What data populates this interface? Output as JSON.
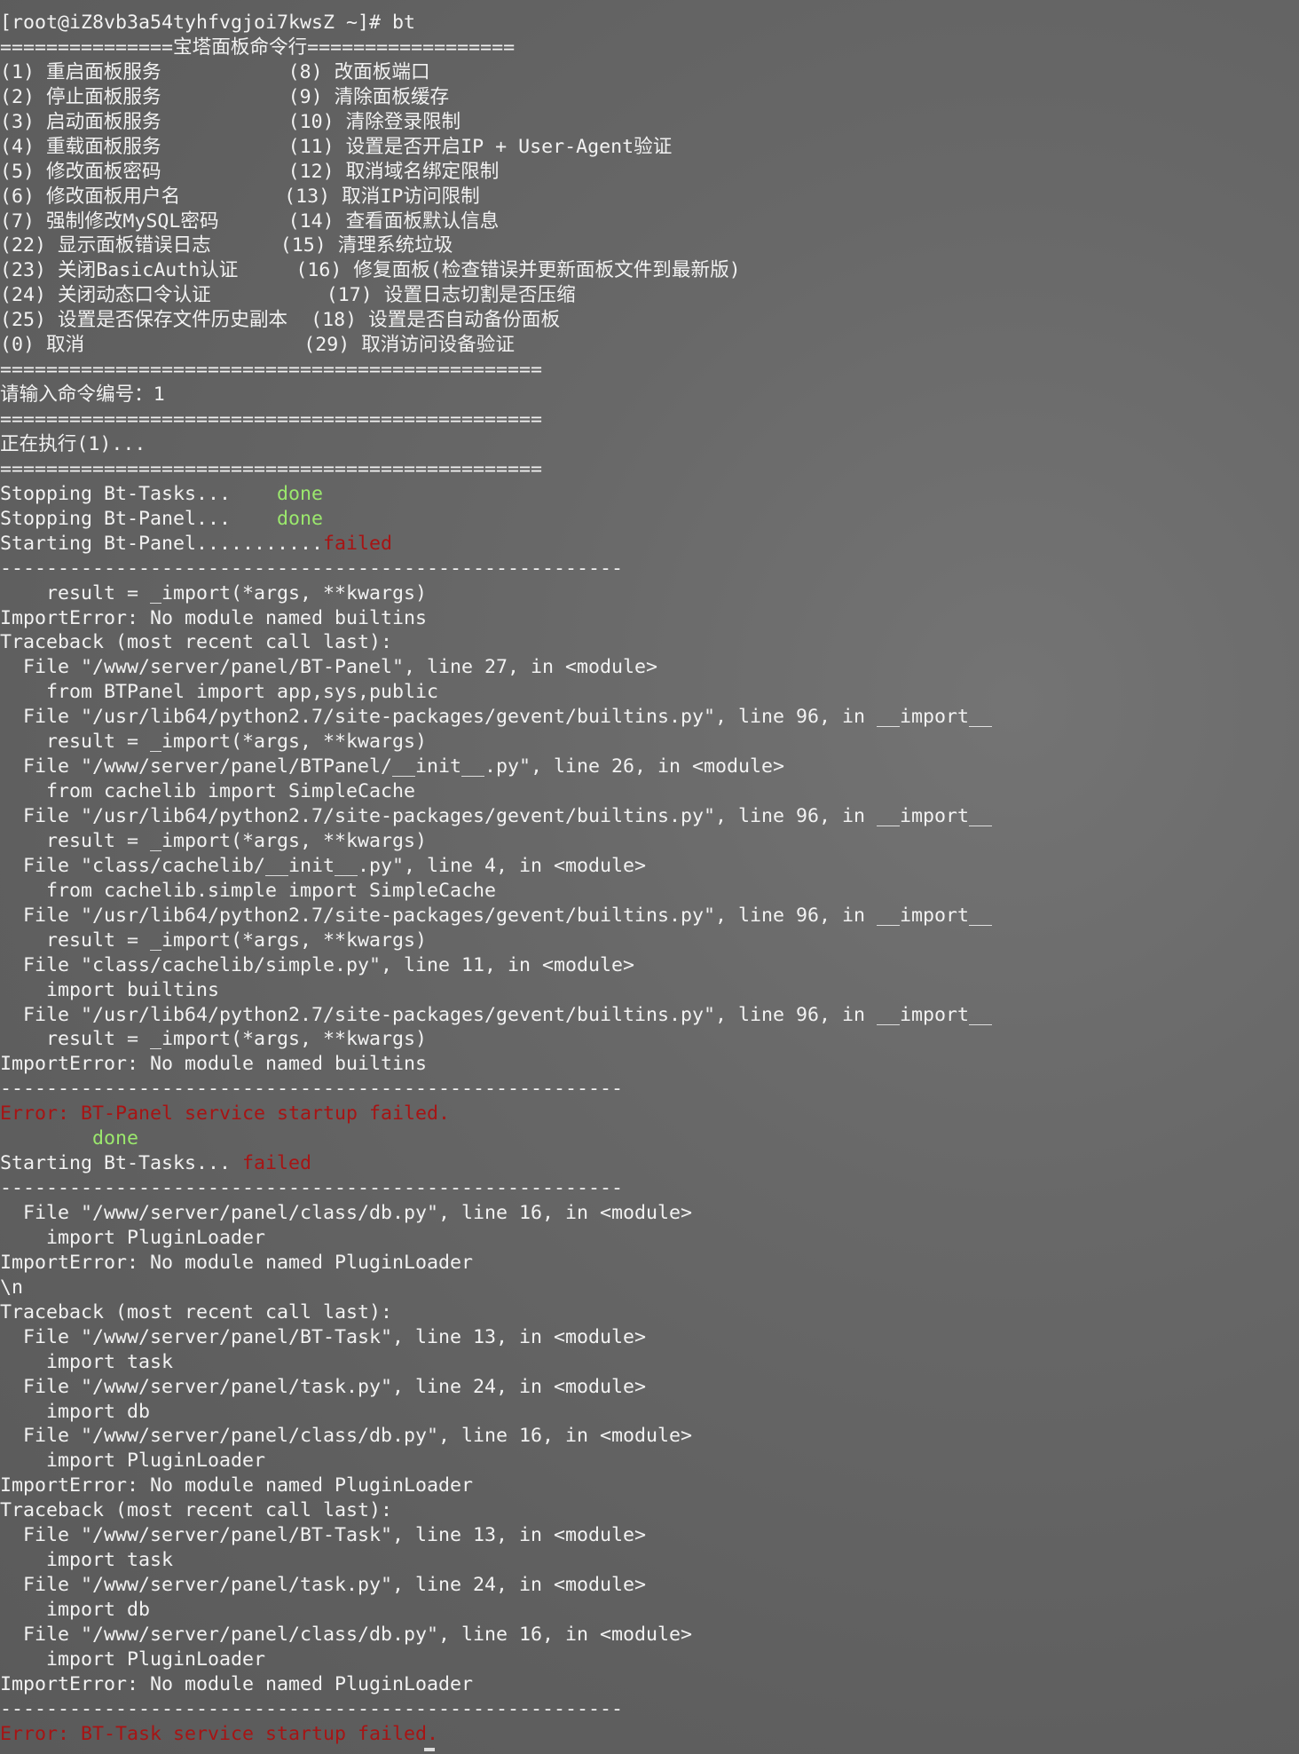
{
  "colors": {
    "background": "#666666",
    "text": "#f2f2f2",
    "success": "#9be86d",
    "failure": "#a71414"
  },
  "lines": [
    {
      "segs": [
        {
          "t": "[root@iZ8vb3a54tyhfvgjoi7kwsZ ~]# bt"
        }
      ]
    },
    {
      "segs": [
        {
          "t": "===============宝塔面板命令行=================="
        }
      ]
    },
    {
      "segs": [
        {
          "t": "(1) 重启面板服务           (8) 改面板端口"
        }
      ]
    },
    {
      "segs": [
        {
          "t": "(2) 停止面板服务           (9) 清除面板缓存"
        }
      ]
    },
    {
      "segs": [
        {
          "t": "(3) 启动面板服务           (10) 清除登录限制"
        }
      ]
    },
    {
      "segs": [
        {
          "t": "(4) 重载面板服务           (11) 设置是否开启IP + User-Agent验证"
        }
      ]
    },
    {
      "segs": [
        {
          "t": "(5) 修改面板密码           (12) 取消域名绑定限制"
        }
      ]
    },
    {
      "segs": [
        {
          "t": "(6) 修改面板用户名         (13) 取消IP访问限制"
        }
      ]
    },
    {
      "segs": [
        {
          "t": "(7) 强制修改MySQL密码      (14) 查看面板默认信息"
        }
      ]
    },
    {
      "segs": [
        {
          "t": "(22) 显示面板错误日志      (15) 清理系统垃圾"
        }
      ]
    },
    {
      "segs": [
        {
          "t": "(23) 关闭BasicAuth认证     (16) 修复面板(检查错误并更新面板文件到最新版)"
        }
      ]
    },
    {
      "segs": [
        {
          "t": "(24) 关闭动态口令认证          (17) 设置日志切割是否压缩"
        }
      ]
    },
    {
      "segs": [
        {
          "t": "(25) 设置是否保存文件历史副本  (18) 设置是否自动备份面板"
        }
      ]
    },
    {
      "segs": [
        {
          "t": "(0) 取消                   (29) 取消访问设备验证"
        }
      ]
    },
    {
      "segs": [
        {
          "t": "==============================================="
        }
      ]
    },
    {
      "segs": [
        {
          "t": "请输入命令编号：1"
        }
      ]
    },
    {
      "segs": [
        {
          "t": "==============================================="
        }
      ]
    },
    {
      "segs": [
        {
          "t": "正在执行(1)..."
        }
      ]
    },
    {
      "segs": [
        {
          "t": "==============================================="
        }
      ]
    },
    {
      "segs": [
        {
          "t": "Stopping Bt-Tasks...    "
        },
        {
          "t": "done",
          "c": "ok"
        }
      ]
    },
    {
      "segs": [
        {
          "t": "Stopping Bt-Panel...    "
        },
        {
          "t": "done",
          "c": "ok"
        }
      ]
    },
    {
      "segs": [
        {
          "t": "Starting Bt-Panel..........."
        },
        {
          "t": "failed",
          "c": "fail"
        }
      ]
    },
    {
      "segs": [
        {
          "t": "------------------------------------------------------"
        }
      ]
    },
    {
      "segs": [
        {
          "t": "    result = _import(*args, **kwargs)"
        }
      ]
    },
    {
      "segs": [
        {
          "t": "ImportError: No module named builtins"
        }
      ]
    },
    {
      "segs": [
        {
          "t": "Traceback (most recent call last):"
        }
      ]
    },
    {
      "segs": [
        {
          "t": "  File \"/www/server/panel/BT-Panel\", line 27, in <module>"
        }
      ]
    },
    {
      "segs": [
        {
          "t": "    from BTPanel import app,sys,public"
        }
      ]
    },
    {
      "segs": [
        {
          "t": "  File \"/usr/lib64/python2.7/site-packages/gevent/builtins.py\", line 96, in __import__"
        }
      ]
    },
    {
      "segs": [
        {
          "t": "    result = _import(*args, **kwargs)"
        }
      ]
    },
    {
      "segs": [
        {
          "t": "  File \"/www/server/panel/BTPanel/__init__.py\", line 26, in <module>"
        }
      ]
    },
    {
      "segs": [
        {
          "t": "    from cachelib import SimpleCache"
        }
      ]
    },
    {
      "segs": [
        {
          "t": "  File \"/usr/lib64/python2.7/site-packages/gevent/builtins.py\", line 96, in __import__"
        }
      ]
    },
    {
      "segs": [
        {
          "t": "    result = _import(*args, **kwargs)"
        }
      ]
    },
    {
      "segs": [
        {
          "t": "  File \"class/cachelib/__init__.py\", line 4, in <module>"
        }
      ]
    },
    {
      "segs": [
        {
          "t": "    from cachelib.simple import SimpleCache"
        }
      ]
    },
    {
      "segs": [
        {
          "t": "  File \"/usr/lib64/python2.7/site-packages/gevent/builtins.py\", line 96, in __import__"
        }
      ]
    },
    {
      "segs": [
        {
          "t": "    result = _import(*args, **kwargs)"
        }
      ]
    },
    {
      "segs": [
        {
          "t": "  File \"class/cachelib/simple.py\", line 11, in <module>"
        }
      ]
    },
    {
      "segs": [
        {
          "t": "    import builtins"
        }
      ]
    },
    {
      "segs": [
        {
          "t": "  File \"/usr/lib64/python2.7/site-packages/gevent/builtins.py\", line 96, in __import__"
        }
      ]
    },
    {
      "segs": [
        {
          "t": "    result = _import(*args, **kwargs)"
        }
      ]
    },
    {
      "segs": [
        {
          "t": "ImportError: No module named builtins"
        }
      ]
    },
    {
      "segs": [
        {
          "t": "------------------------------------------------------"
        }
      ]
    },
    {
      "segs": [
        {
          "t": "Error: BT-Panel service startup failed.",
          "c": "err"
        }
      ]
    },
    {
      "segs": [
        {
          "t": "        "
        },
        {
          "t": "done",
          "c": "ok"
        }
      ]
    },
    {
      "segs": [
        {
          "t": "Starting Bt-Tasks... "
        },
        {
          "t": "failed",
          "c": "fail"
        }
      ]
    },
    {
      "segs": [
        {
          "t": "------------------------------------------------------"
        }
      ]
    },
    {
      "segs": [
        {
          "t": "  File \"/www/server/panel/class/db.py\", line 16, in <module>"
        }
      ]
    },
    {
      "segs": [
        {
          "t": "    import PluginLoader"
        }
      ]
    },
    {
      "segs": [
        {
          "t": "ImportError: No module named PluginLoader"
        }
      ]
    },
    {
      "segs": [
        {
          "t": "\\n"
        }
      ]
    },
    {
      "segs": [
        {
          "t": "Traceback (most recent call last):"
        }
      ]
    },
    {
      "segs": [
        {
          "t": "  File \"/www/server/panel/BT-Task\", line 13, in <module>"
        }
      ]
    },
    {
      "segs": [
        {
          "t": "    import task"
        }
      ]
    },
    {
      "segs": [
        {
          "t": "  File \"/www/server/panel/task.py\", line 24, in <module>"
        }
      ]
    },
    {
      "segs": [
        {
          "t": "    import db"
        }
      ]
    },
    {
      "segs": [
        {
          "t": "  File \"/www/server/panel/class/db.py\", line 16, in <module>"
        }
      ]
    },
    {
      "segs": [
        {
          "t": "    import PluginLoader"
        }
      ]
    },
    {
      "segs": [
        {
          "t": "ImportError: No module named PluginLoader"
        }
      ]
    },
    {
      "segs": [
        {
          "t": "Traceback (most recent call last):"
        }
      ]
    },
    {
      "segs": [
        {
          "t": "  File \"/www/server/panel/BT-Task\", line 13, in <module>"
        }
      ]
    },
    {
      "segs": [
        {
          "t": "    import task"
        }
      ]
    },
    {
      "segs": [
        {
          "t": "  File \"/www/server/panel/task.py\", line 24, in <module>"
        }
      ]
    },
    {
      "segs": [
        {
          "t": "    import db"
        }
      ]
    },
    {
      "segs": [
        {
          "t": "  File \"/www/server/panel/class/db.py\", line 16, in <module>"
        }
      ]
    },
    {
      "segs": [
        {
          "t": "    import PluginLoader"
        }
      ]
    },
    {
      "segs": [
        {
          "t": "ImportError: No module named PluginLoader"
        }
      ]
    },
    {
      "segs": [
        {
          "t": "------------------------------------------------------"
        }
      ]
    },
    {
      "segs": [
        {
          "t": "Error: BT-Task service startup failed.",
          "c": "err"
        }
      ]
    }
  ]
}
